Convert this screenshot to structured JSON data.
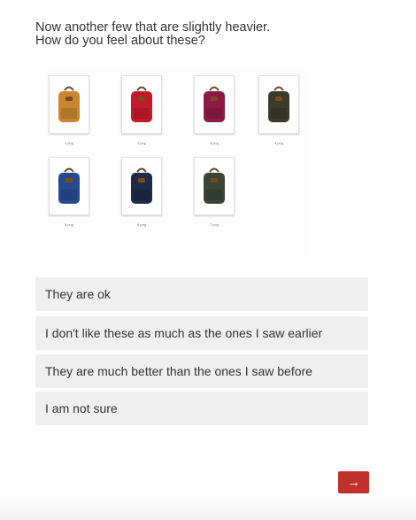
{
  "question": {
    "line1": "Now another few that are slightly heavier.",
    "line2": "How do you feel about these?"
  },
  "images": [
    {
      "file": "1.png",
      "color_name": "ochre-backpack-icon",
      "color": "#c8862f"
    },
    {
      "file": "2.png",
      "color_name": "red-backpack-icon",
      "color": "#c21a2a"
    },
    {
      "file": "3.png",
      "color_name": "plum-backpack-icon",
      "color": "#8c1a45"
    },
    {
      "file": "4.png",
      "color_name": "dark-olive-backpack-icon",
      "color": "#3b3a2b"
    },
    {
      "file": "5.png",
      "color_name": "royal-blue-backpack-icon",
      "color": "#27498f"
    },
    {
      "file": "6.png",
      "color_name": "navy-backpack-icon",
      "color": "#1d2a48"
    },
    {
      "file": "7.png",
      "color_name": "forest-green-backpack-icon",
      "color": "#3a4535"
    }
  ],
  "choices": [
    "They are ok",
    "I don't like these as much as the ones I saw earlier",
    "They are much better than the ones I saw before",
    "I am not sure"
  ],
  "next_button": {
    "icon": "arrow-right-icon",
    "glyph": "→",
    "color": "#c0312b"
  }
}
